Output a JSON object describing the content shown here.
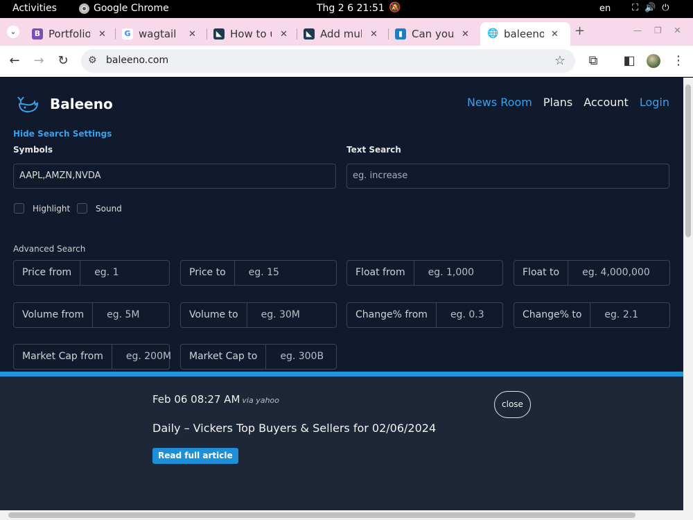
{
  "os": {
    "activities": "Activities",
    "app_name": "Google Chrome",
    "clock": "Thg 2 6  21:51",
    "lang": "en"
  },
  "tabs": [
    {
      "title": "Portfolio",
      "favicon": "B",
      "color": "#7a4fb5"
    },
    {
      "title": "wagtail li",
      "favicon": "G",
      "color": "#4285f4"
    },
    {
      "title": "How to u",
      "favicon": "",
      "color": "#1b3a4b"
    },
    {
      "title": "Add mult",
      "favicon": "",
      "color": "#1b3a4b"
    },
    {
      "title": "Can you l",
      "favicon": "",
      "color": "#1a7fc4"
    },
    {
      "title": "baleeno.c",
      "favicon": "",
      "color": "#666666"
    }
  ],
  "toolbar": {
    "url": "baleeno.com"
  },
  "site": {
    "brand": "Baleeno",
    "nav": [
      "News Room",
      "Plans",
      "Account",
      "Login"
    ]
  },
  "search": {
    "hide_link": "Hide Search Settings",
    "symbols_label": "Symbols",
    "symbols_value": "AAPL,AMZN,NVDA",
    "text_label": "Text Search",
    "text_placeholder": "eg. increase",
    "highlight_label": "Highlight",
    "sound_label": "Sound",
    "advanced_label": "Advanced Search",
    "filters": [
      {
        "label": "Price from",
        "placeholder": "eg. 1"
      },
      {
        "label": "Price to",
        "placeholder": "eg. 15"
      },
      {
        "label": "Float from",
        "placeholder": "eg. 1,000"
      },
      {
        "label": "Float to",
        "placeholder": "eg. 4,000,000"
      },
      {
        "label": "Volume from",
        "placeholder": "eg. 5M"
      },
      {
        "label": "Volume to",
        "placeholder": "eg. 30M"
      },
      {
        "label": "Change% from",
        "placeholder": "eg. 0.3"
      },
      {
        "label": "Change% to",
        "placeholder": "eg. 2.1"
      },
      {
        "label": "Market Cap from",
        "placeholder": "eg. 200M"
      },
      {
        "label": "Market Cap to",
        "placeholder": "eg. 300B"
      }
    ]
  },
  "news": {
    "time": "Feb 06 08:27 AM",
    "via": "via yahoo",
    "headline": "Daily – Vickers Top Buyers & Sellers for 02/06/2024",
    "read_label": "Read full article",
    "close_label": "close"
  },
  "colors": {
    "page_bg": "#101a2c",
    "accent": "#1e95dd",
    "link": "#3aa0ea"
  }
}
